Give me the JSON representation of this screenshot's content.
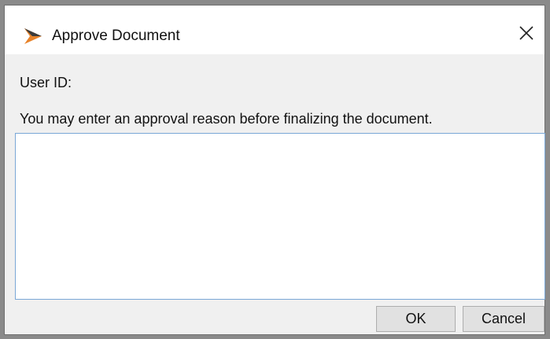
{
  "window": {
    "title": "Approve Document",
    "app_icon": "approve-chevron-icon",
    "close_icon": "close-icon"
  },
  "form": {
    "user_id_label": "User ID:",
    "instruction": "You may enter an approval reason before finalizing the document.",
    "reason_value": ""
  },
  "buttons": {
    "ok_label": "OK",
    "cancel_label": "Cancel"
  },
  "colors": {
    "icon_orange": "#e8832a",
    "icon_dark": "#3b3b3b",
    "input_border_focus": "#7aa7d6",
    "dialog_background": "#f0f0f0"
  }
}
